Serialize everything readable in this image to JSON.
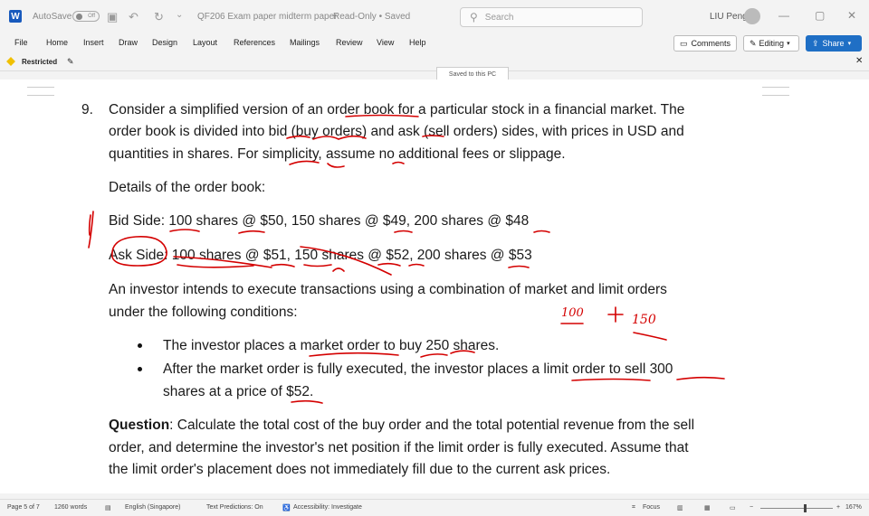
{
  "titlebar": {
    "autosave_label": "AutoSave",
    "autosave_state": "Off",
    "doc_title": "QF206 Exam paper midterm paper",
    "doc_status": "Read-Only • Saved",
    "search_placeholder": "Search",
    "user_name": "LIU Peng"
  },
  "menu": [
    "File",
    "Home",
    "Insert",
    "Draw",
    "Design",
    "Layout",
    "References",
    "Mailings",
    "Review",
    "View",
    "Help"
  ],
  "ribbon_buttons": {
    "comments": "Comments",
    "editing": "Editing",
    "share": "Share"
  },
  "restricted_label": "Restricted",
  "saved_tooltip": "Saved to this PC",
  "document": {
    "number": "9.",
    "para1": [
      "Consider a simplified version of an order book for a particular stock in a financial market. The",
      "order book is divided into bid (buy orders) and ask (sell orders) sides, with prices in USD and",
      "quantities in shares. For simplicity, assume no additional fees or slippage."
    ],
    "details_heading": "Details of the order book:",
    "bid_side": "Bid Side: 100 shares @ $50, 150 shares @ $49, 200 shares @ $48",
    "ask_side": "Ask Side: 100 shares @ $51, 150 shares @ $52, 200 shares @ $53",
    "para2": [
      "An investor intends to execute transactions using a combination of market and limit orders",
      "under the following conditions:"
    ],
    "bullet1": "The investor places a market order to buy 250 shares.",
    "bullet2": [
      "After the market order is fully executed, the investor places a limit order to sell 300",
      "shares at a price of $52."
    ],
    "question_label": "Question",
    "question": [
      ": Calculate the total cost of the buy order and the total potential revenue from the sell",
      "order, and determine the investor's net position if the limit order is fully executed. Assume that",
      "the limit order's placement does not immediately fill due to the current ask prices."
    ],
    "annotation": "100  +  150"
  },
  "status": {
    "page": "Page 5 of 7",
    "words": "1260 words",
    "language": "English (Singapore)",
    "predictions": "Text Predictions: On",
    "accessibility": "Accessibility: Investigate",
    "focus": "Focus",
    "zoom": "167%"
  },
  "colors": {
    "ink": "#d40000",
    "share_blue": "#1f6fc5",
    "word_blue": "#185abd"
  }
}
